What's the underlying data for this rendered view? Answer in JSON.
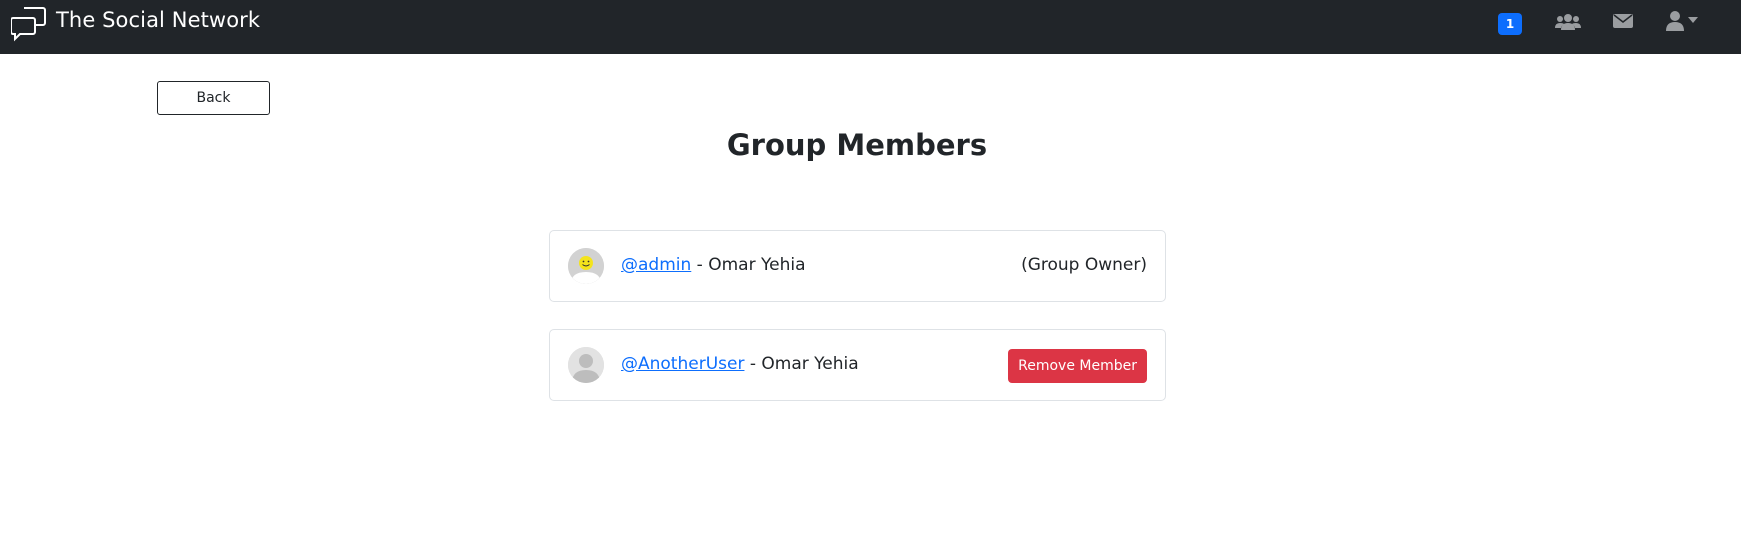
{
  "navbar": {
    "brand_name": "The Social Network",
    "brand_icon": "chat-bubbles-icon",
    "notification_count": "1",
    "icons": [
      "users-icon",
      "envelope-icon",
      "user-icon",
      "caret-down-icon"
    ],
    "background": "#212529",
    "badge_color": "#0d6efd"
  },
  "back_button": {
    "label": "Back"
  },
  "page": {
    "title": "Group Members"
  },
  "members": [
    {
      "username": "@admin",
      "separator": " - ",
      "full_name": "Omar Yehia",
      "role_label": "(Group Owner)",
      "avatar": "smiley-avatar"
    },
    {
      "username": "@AnotherUser",
      "separator": " - ",
      "full_name": "Omar Yehia",
      "action_label": "Remove Member",
      "avatar": "default-user-avatar"
    }
  ],
  "colors": {
    "link": "#0d6efd",
    "danger": "#dc3545",
    "card_border": "#dee2e6"
  }
}
